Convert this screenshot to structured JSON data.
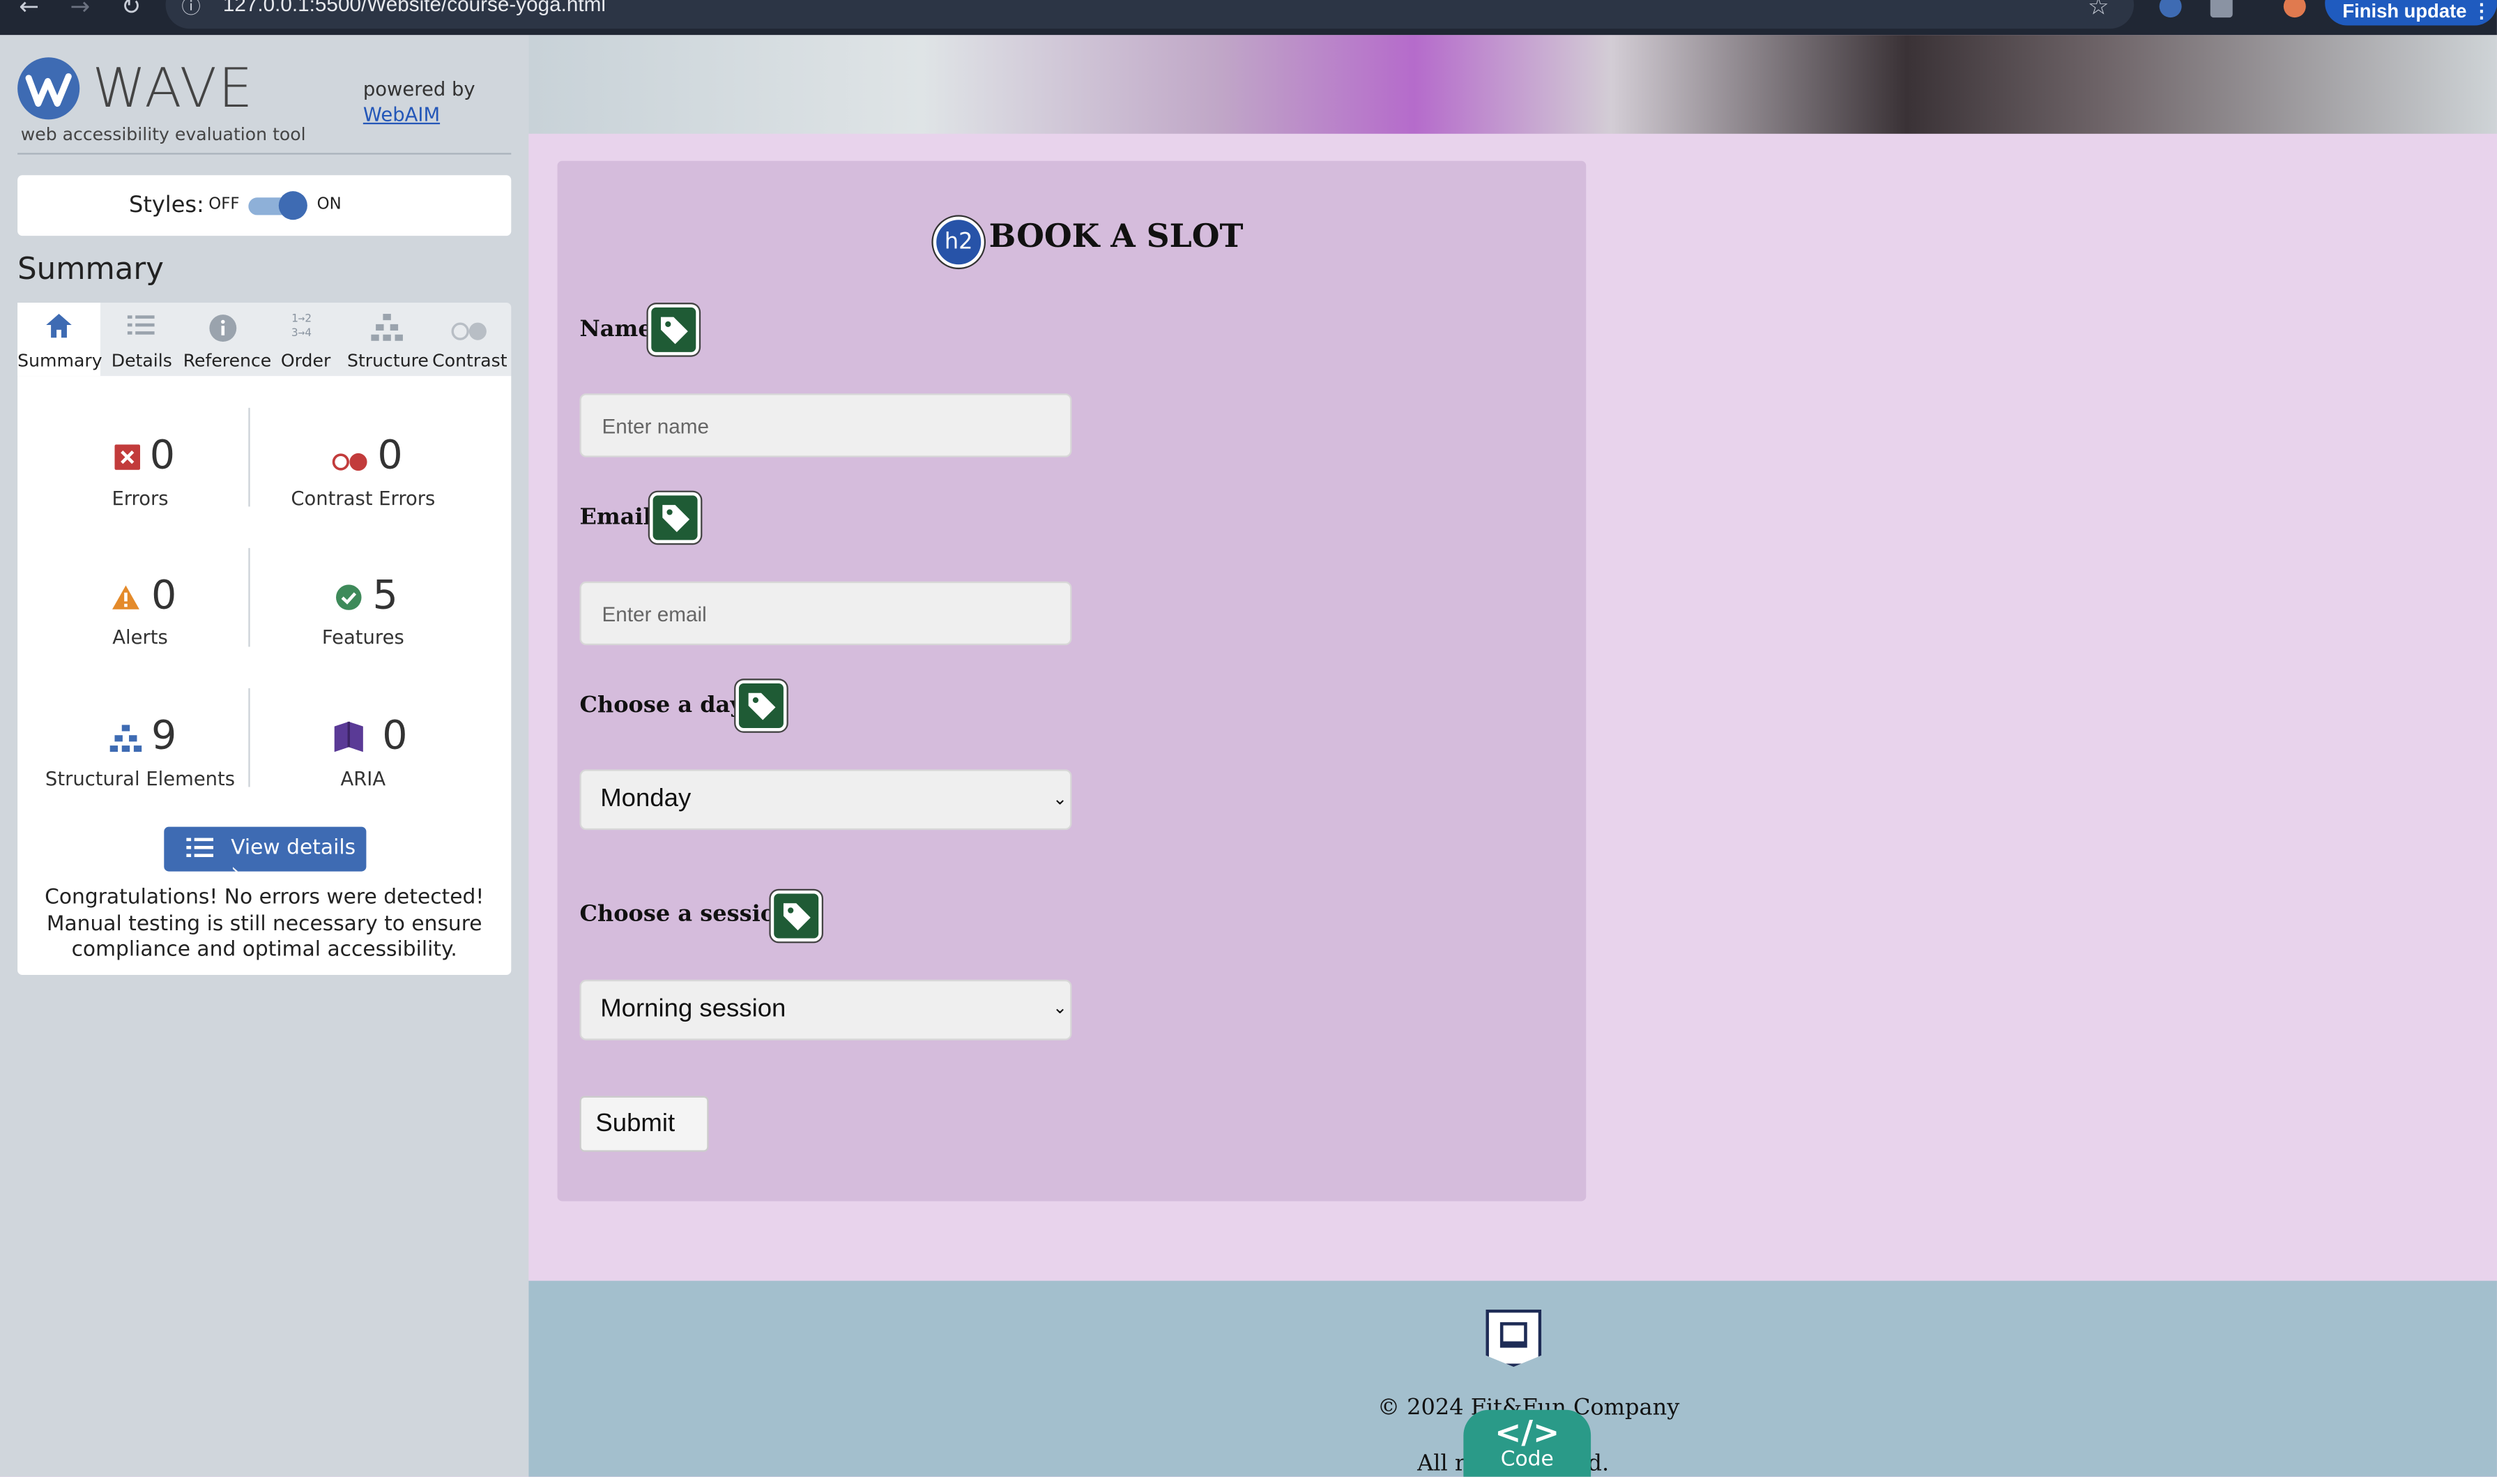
{
  "browser": {
    "url": "127.0.0.1:5500/Website/course-yoga.html",
    "update_label": "Finish update"
  },
  "wave": {
    "title": "WAVE",
    "subtitle": "web accessibility evaluation tool",
    "powered_by": "powered by",
    "webaim_link": "WebAIM",
    "styles_label": "Styles:",
    "styles_off": "OFF",
    "styles_on": "ON",
    "styles_enabled": true,
    "summary_title": "Summary",
    "tabs": [
      {
        "label": "Summary",
        "icon": "home-icon",
        "active": true
      },
      {
        "label": "Details",
        "icon": "list-icon"
      },
      {
        "label": "Reference",
        "icon": "info-icon"
      },
      {
        "label": "Order",
        "icon": "order-icon"
      },
      {
        "label": "Structure",
        "icon": "structure-icon"
      },
      {
        "label": "Contrast",
        "icon": "contrast-icon"
      }
    ],
    "stats": {
      "errors": {
        "count": "0",
        "label": "Errors"
      },
      "contrast_errors": {
        "count": "0",
        "label": "Contrast Errors"
      },
      "alerts": {
        "count": "0",
        "label": "Alerts"
      },
      "features": {
        "count": "5",
        "label": "Features"
      },
      "structural": {
        "count": "9",
        "label": "Structural Elements"
      },
      "aria": {
        "count": "0",
        "label": "ARIA"
      }
    },
    "view_details": "View details ›",
    "congrats": "Congratulations! No errors were detected! Manual testing is still necessary to ensure compliance and optimal accessibility."
  },
  "form": {
    "h2_badge": "h2",
    "heading": "BOOK A SLOT",
    "name_label": "Name:",
    "name_placeholder": "Enter name",
    "email_label": "Email:",
    "email_placeholder": "Enter email",
    "day_label": "Choose a day:",
    "day_value": "Monday",
    "session_label": "Choose a session:",
    "session_value": "Morning session",
    "submit": "Submit"
  },
  "footer": {
    "copyright": "© 2024 Fit&Fun Company",
    "rights_start": "All r",
    "rights_end": "d.",
    "code_symbol": "</>",
    "code_label": "Code"
  },
  "colors": {
    "wave_blue": "#3e6bb3",
    "tag_green": "#1f5b35",
    "card_bg": "#d5bcdc",
    "page_bg": "#e8d3ec",
    "footer_bg": "#a3bfcd"
  }
}
